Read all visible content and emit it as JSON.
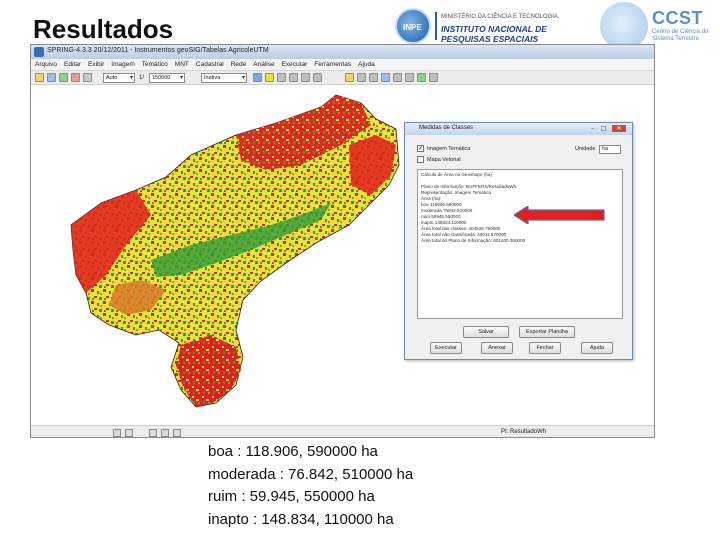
{
  "slide": {
    "title": "Resultados"
  },
  "logos": {
    "inpe": {
      "globe_text": "INPE",
      "line1": "MINISTÉRIO DA CIÊNCIA E TECNOLOGIA",
      "line2": "INSTITUTO NACIONAL DE PESQUISAS ESPACIAIS"
    },
    "ccst": {
      "acronym": "CCST",
      "subtitle": "Centro de Ciência do Sistema Terrestre"
    }
  },
  "app": {
    "window_title": "SPRING-4.3.3  20/12/2011 - Instrumentos  geoSIG/Tabelas AgricoleUTM",
    "menu": [
      "Arquivo",
      "Editar",
      "Exibir",
      "Imagem",
      "Temático",
      "MNT",
      "Cadastral",
      "Rede",
      "Análise",
      "Executar",
      "Ferramentas",
      "Ajuda"
    ],
    "toolbar": {
      "select1": "Auto",
      "zoom_label": "1/",
      "select2": "150000",
      "select3": "Inativa"
    },
    "status_text": "PI: ResultadoWh"
  },
  "dialog": {
    "title": "Medidas de Classes",
    "checkbox_imagem_tematica": "Imagem Temática",
    "checkbox_mapa_vetorial": "Mapa Vetorial",
    "unit_label": "Unidade",
    "unit_value": "ha",
    "results_lines": [
      "Cálculo de Área no Geoshape (ha)",
      "",
      "Plano de Informação: BUFFERS/ResultadoWh",
      "Representação: Imagem Temática",
      "Área (ha):",
      "  boa        118906.590000",
      "  moderada    76842.510000",
      "  ruim        59945.550000",
      "  inapto     148834.110000",
      "Área total das classes: 404528.760000",
      "Área total não classificada: 40011.570000",
      "Área total do Plano de Informação: 801400.360000"
    ],
    "buttons": {
      "salvar": "Salvar",
      "exportar_planilha": "Exportar Planilha",
      "executar": "Executar",
      "anexar": "Anexar",
      "fechar": "Fechar",
      "ajuda": "Ajuda"
    }
  },
  "results": [
    "boa  :  118.906, 590000 ha",
    "moderada  :  76.842, 510000 ha",
    "ruim  :  59.945, 550000 ha",
    "inapto  :  148.834, 110000 ha"
  ],
  "colors": {
    "boa": "#2e9e3a",
    "moderada": "#e8e23a",
    "ruim": "#d87a2a",
    "inapto": "#e02020",
    "arrow": "#e02020"
  }
}
